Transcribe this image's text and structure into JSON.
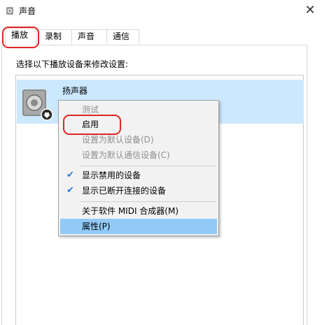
{
  "window": {
    "title": "声音"
  },
  "tabs": [
    {
      "label": "播放"
    },
    {
      "label": "录制"
    },
    {
      "label": "声音"
    },
    {
      "label": "通信"
    }
  ],
  "panel": {
    "instruction": "选择以下播放设备来修改设置:"
  },
  "device": {
    "name": "扬声器",
    "sublabel": "..."
  },
  "context_menu": {
    "items": [
      {
        "label": "测试",
        "state": "disabled"
      },
      {
        "label": "启用",
        "state": "enabled"
      },
      {
        "label": "设置为默认设备(D)",
        "state": "disabled"
      },
      {
        "label": "设置为默认通信设备(C)",
        "state": "disabled"
      },
      {
        "label": "显示禁用的设备",
        "state": "checked"
      },
      {
        "label": "显示已断开连接的设备",
        "state": "checked"
      },
      {
        "label": "关于软件 MIDI 合成器(M)",
        "state": "enabled"
      },
      {
        "label": "属性(P)",
        "state": "highlighted"
      }
    ]
  },
  "colors": {
    "selection": "#cce8ff",
    "menu_highlight": "#91c9f7",
    "annotation_ring": "#e02525",
    "check": "#2a7bd4"
  },
  "icons": [
    "speaker-title-icon",
    "close-icon",
    "speaker-device-icon",
    "disabled-arrow-icon",
    "checkmark-icon"
  ]
}
